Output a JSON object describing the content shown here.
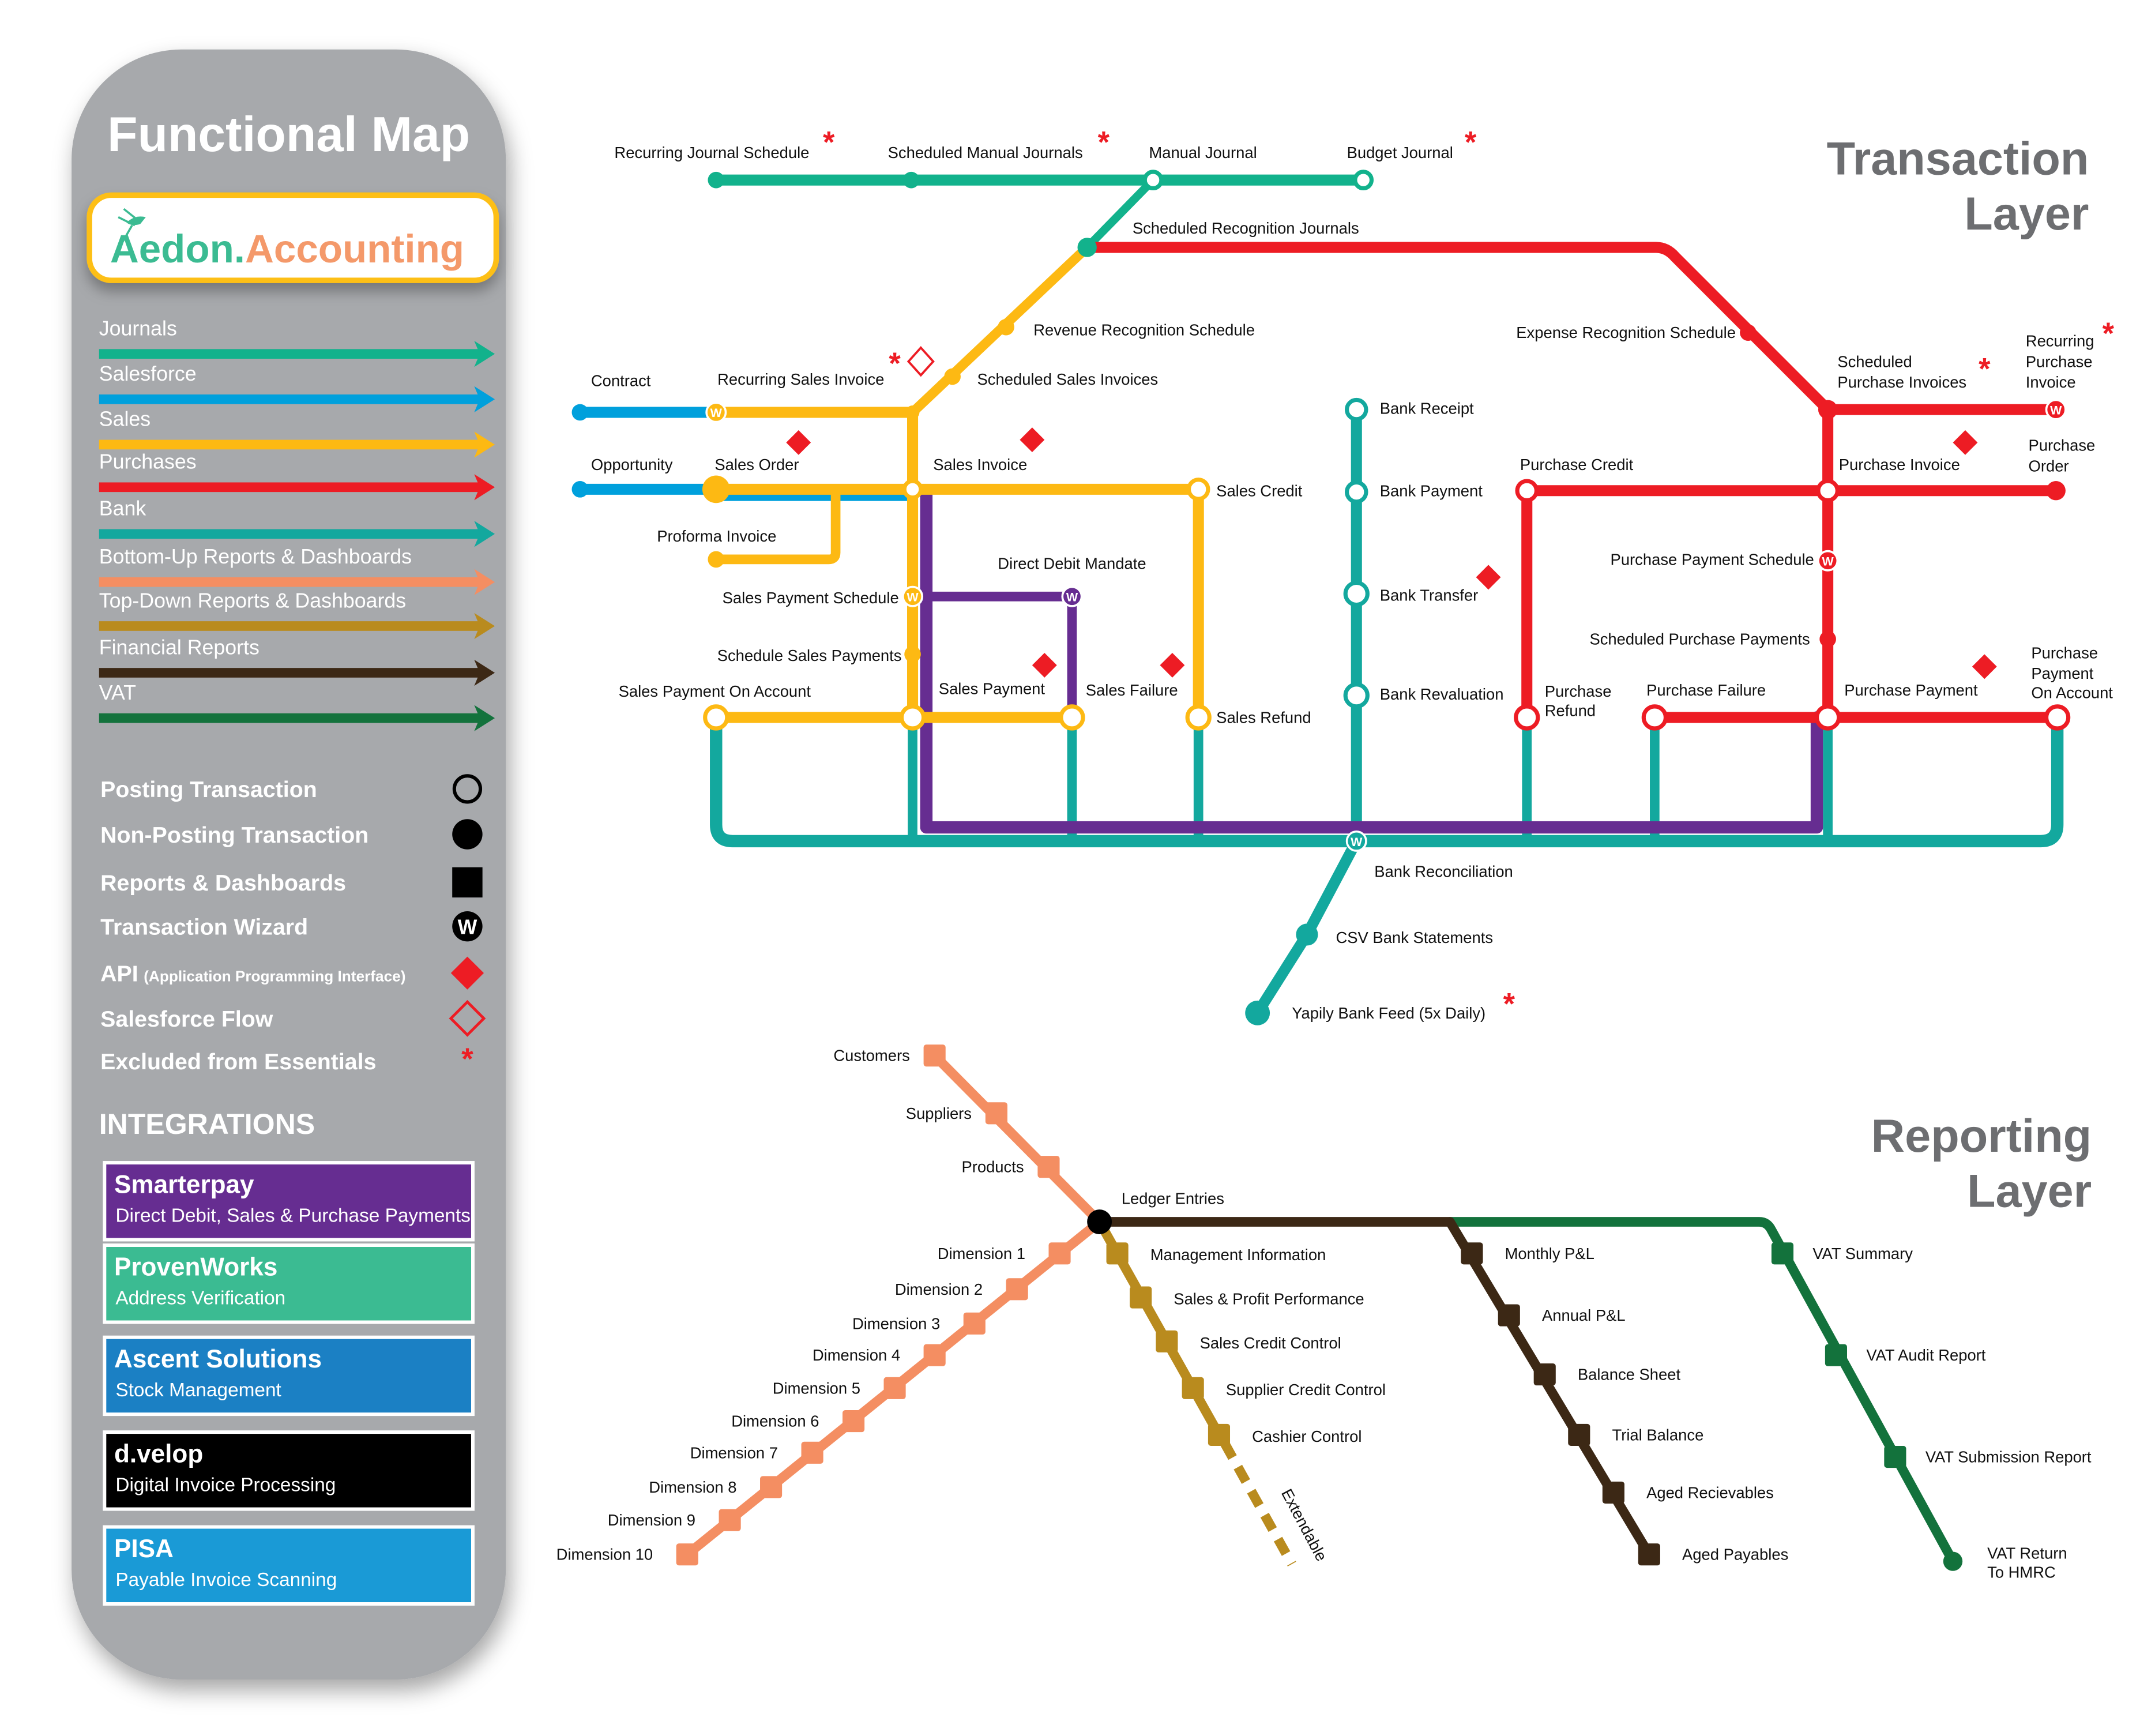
{
  "sidebar": {
    "title": "Functional Map",
    "logo": {
      "part1": "Aedon",
      "dot": ".",
      "part2": "Accounting",
      "part1_color": "#3bbb92",
      "part2_color": "#f4996a",
      "border_color": "#fdbf16"
    },
    "lines_legend": [
      {
        "label": "Journals",
        "color": "#12b28c"
      },
      {
        "label": "Salesforce",
        "color": "#00a0dc"
      },
      {
        "label": "Sales",
        "color": "#fdb913"
      },
      {
        "label": "Purchases",
        "color": "#ed1c24"
      },
      {
        "label": "Bank",
        "color": "#13a89e"
      },
      {
        "label": "Bottom-Up Reports & Dashboards",
        "color": "#f48e62"
      },
      {
        "label": "Top-Down Reports & Dashboards",
        "color": "#b98b1e"
      },
      {
        "label": "Financial Reports",
        "color": "#3c2815"
      },
      {
        "label": "VAT",
        "color": "#13723c"
      }
    ],
    "symbol_key": [
      {
        "label": "Posting Transaction",
        "icon": "open-circle-icon"
      },
      {
        "label": "Non-Posting Transaction",
        "icon": "filled-circle-icon"
      },
      {
        "label": "Reports & Dashboards",
        "icon": "filled-square-icon"
      },
      {
        "label": "Transaction Wizard",
        "icon": "wizard-w-icon",
        "glyph": "W"
      },
      {
        "label": "API",
        "label_suffix": "(Application Programming Interface)",
        "icon": "api-diamond-icon"
      },
      {
        "label": "Salesforce Flow",
        "icon": "salesforce-flow-diamond-icon"
      },
      {
        "label": "Excluded from Essentials",
        "icon": "asterisk-icon",
        "glyph": "*"
      }
    ],
    "integrations_heading": "INTEGRATIONS",
    "integrations": [
      {
        "name": "Smarterpay",
        "description": "Direct Debit, Sales & Purchase Payments",
        "color": "#662d91"
      },
      {
        "name": "ProvenWorks",
        "description": "Address Verification",
        "color": "#3bbb92"
      },
      {
        "name": "Ascent Solutions",
        "description": "Stock Management",
        "color": "#1b80c4"
      },
      {
        "name": "d.velop",
        "description": "Digital Invoice Processing",
        "color": "#000000"
      },
      {
        "name": "PISA",
        "description": "Payable Invoice Scanning",
        "color": "#1a9ad6"
      }
    ]
  },
  "transaction_layer": {
    "title_line1": "Transaction",
    "title_line2": "Layer",
    "stations": {
      "recurring_journal_schedule": "Recurring Journal Schedule",
      "scheduled_manual_journals": "Scheduled Manual Journals",
      "manual_journal": "Manual Journal",
      "budget_journal": "Budget Journal",
      "scheduled_recognition_journals": "Scheduled Recognition Journals",
      "revenue_recognition_schedule": "Revenue Recognition Schedule",
      "scheduled_sales_invoices": "Scheduled Sales Invoices",
      "recurring_sales_invoice": "Recurring Sales Invoice",
      "contract": "Contract",
      "opportunity": "Opportunity",
      "sales_order": "Sales Order",
      "sales_invoice": "Sales Invoice",
      "sales_credit": "Sales Credit",
      "proforma_invoice": "Proforma Invoice",
      "direct_debit_mandate": "Direct Debit Mandate",
      "sales_payment_schedule": "Sales Payment Schedule",
      "schedule_sales_payments": "Schedule Sales Payments",
      "sales_payment_on_account": "Sales Payment On Account",
      "sales_payment": "Sales Payment",
      "sales_failure": "Sales Failure",
      "sales_refund": "Sales Refund",
      "bank_receipt": "Bank Receipt",
      "bank_payment": "Bank Payment",
      "bank_transfer": "Bank Transfer",
      "bank_revaluation": "Bank Revaluation",
      "bank_reconciliation": "Bank Reconciliation",
      "csv_bank_statements": "CSV Bank Statements",
      "yapily_bank_feed": "Yapily Bank Feed (5x Daily)",
      "expense_recognition_schedule": "Expense Recognition Schedule",
      "scheduled_purchase_invoices_1": "Scheduled",
      "scheduled_purchase_invoices_2": "Purchase Invoices",
      "recurring_purchase_invoice_1": "Recurring",
      "recurring_purchase_invoice_2": "Purchase",
      "recurring_purchase_invoice_3": "Invoice",
      "purchase_credit": "Purchase Credit",
      "purchase_invoice": "Purchase Invoice",
      "purchase_order_1": "Purchase",
      "purchase_order_2": "Order",
      "purchase_payment_schedule": "Purchase Payment Schedule",
      "scheduled_purchase_payments": "Scheduled Purchase Payments",
      "purchase_refund_1": "Purchase",
      "purchase_refund_2": "Refund",
      "purchase_failure": "Purchase Failure",
      "purchase_payment": "Purchase Payment",
      "purchase_payment_on_account_1": "Purchase",
      "purchase_payment_on_account_2": "Payment",
      "purchase_payment_on_account_3": "On Account"
    },
    "wizard_glyph": "W",
    "star_glyph": "*"
  },
  "reporting_layer": {
    "title_line1": "Reporting",
    "title_line2": "Layer",
    "hub": "Ledger Entries",
    "bottom_up_upper": [
      "Customers",
      "Suppliers",
      "Products"
    ],
    "bottom_up_lower": [
      "Dimension 1",
      "Dimension 2",
      "Dimension 3",
      "Dimension 4",
      "Dimension 5",
      "Dimension 6",
      "Dimension 7",
      "Dimension 8",
      "Dimension 9",
      "Dimension 10"
    ],
    "top_down": [
      "Management Information",
      "Sales & Profit Performance",
      "Sales Credit Control",
      "Supplier Credit Control",
      "Cashier Control"
    ],
    "top_down_extension": "Extendable",
    "financial_reports": [
      "Monthly P&L",
      "Annual P&L",
      "Balance Sheet",
      "Trial Balance",
      "Aged Recievables",
      "Aged Payables"
    ],
    "vat": [
      "VAT Summary",
      "VAT Audit Report",
      "VAT Submission Report"
    ],
    "vat_terminal_1": "VAT Return",
    "vat_terminal_2": "To HMRC"
  }
}
